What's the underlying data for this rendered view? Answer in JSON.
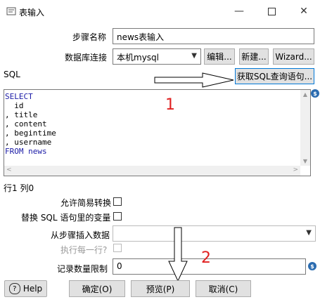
{
  "window": {
    "title": "表输入"
  },
  "form": {
    "step_name_label": "步骤名称",
    "step_name_value": "news表输入",
    "db_conn_label": "数据库连接",
    "db_conn_value": "本机mysql",
    "edit_btn": "编辑...",
    "new_btn": "新建...",
    "wizard_btn": "Wizard...",
    "sql_label": "SQL",
    "get_sql_btn": "获取SQL查询语句...",
    "sql_lines": [
      "SELECT",
      "  id",
      ", title",
      ", content",
      ", begintime",
      ", username",
      "FROM news"
    ],
    "position": "行1 列0",
    "lazy_conv_label": "允许简易转换",
    "replace_vars_label": "替换 SQL 语句里的变量",
    "insert_from_label": "从步骤插入数据",
    "exec_each_label": "执行每一行?",
    "limit_label": "记录数量限制",
    "limit_value": "0"
  },
  "buttons": {
    "help": "Help",
    "ok": "确定(O)",
    "preview": "预览(P)",
    "cancel": "取消(C)"
  },
  "annotations": {
    "one": "1",
    "two": "2"
  },
  "colors": {
    "annotation": "#e02020",
    "keyword": "#1a1aa6",
    "variable_icon": "#2b6cb0"
  }
}
